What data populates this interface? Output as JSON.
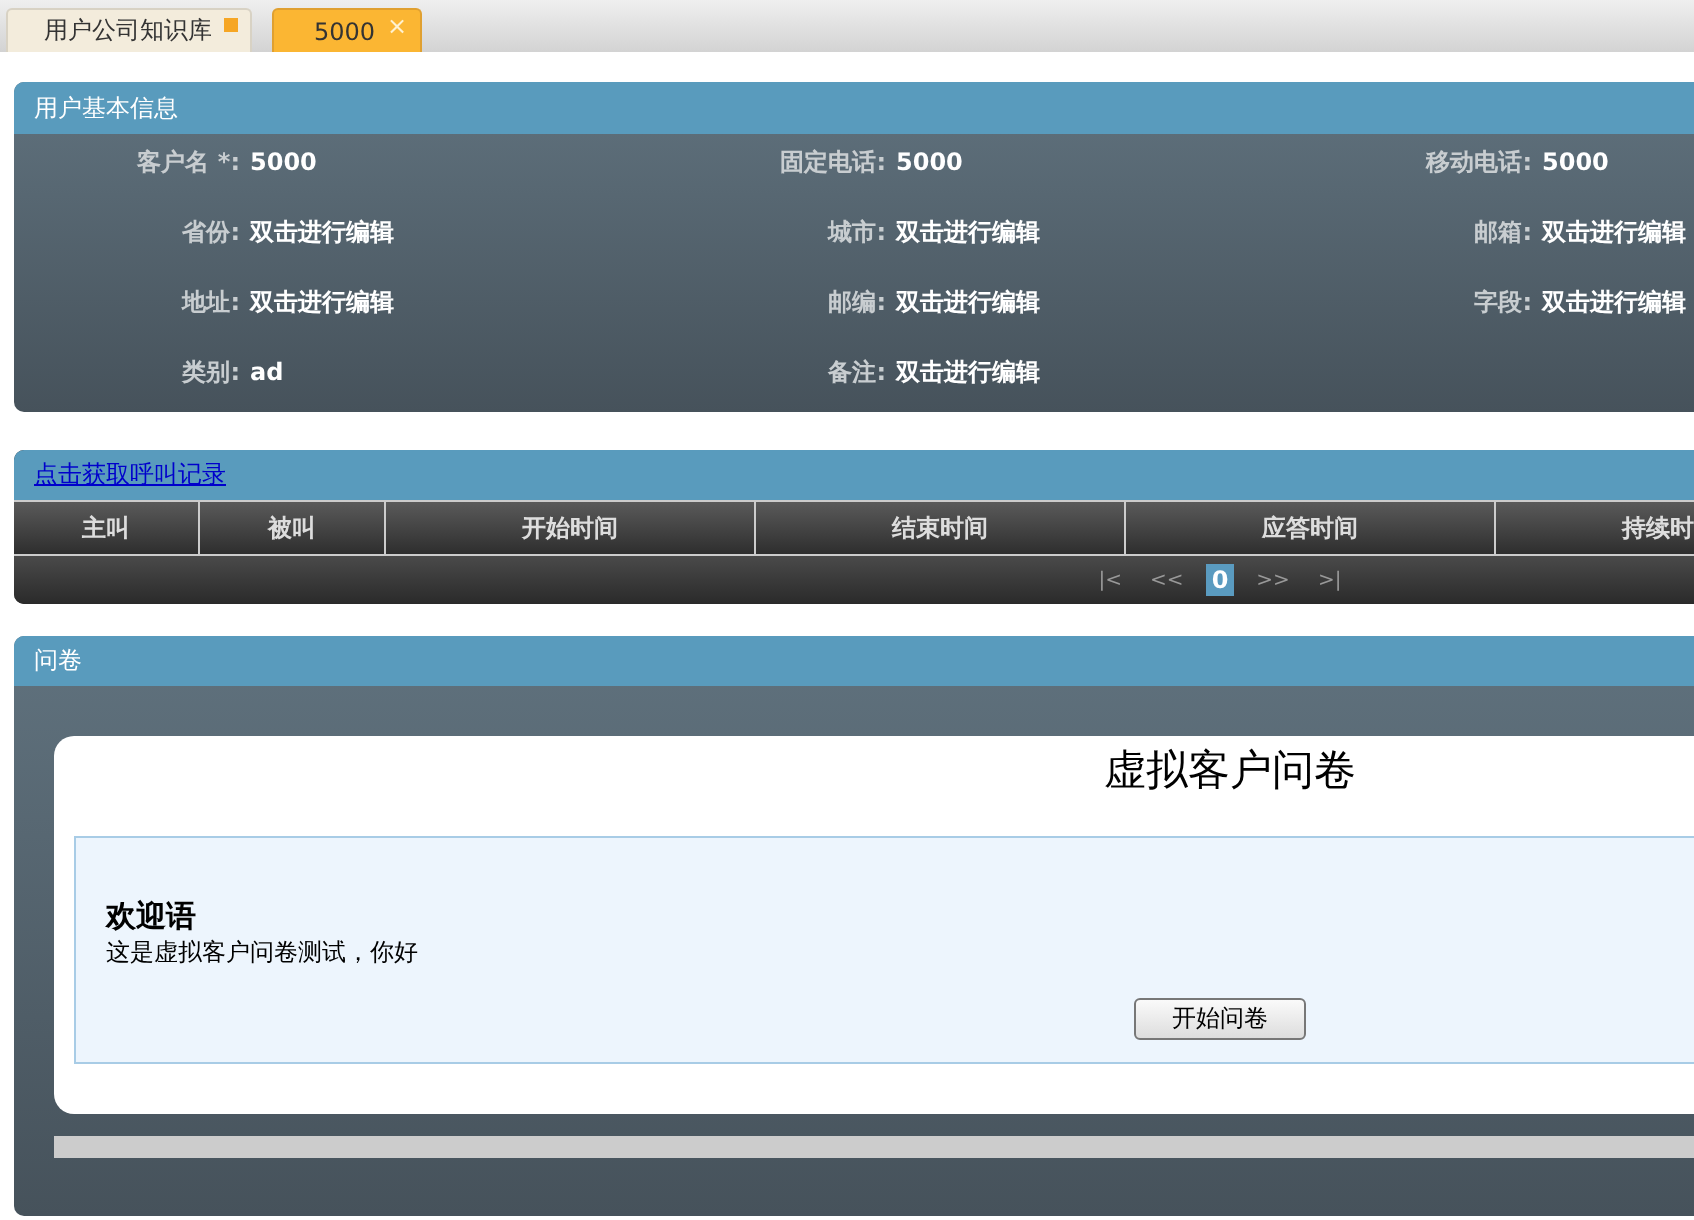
{
  "tabs": [
    {
      "label": "用户公司知识库",
      "selected": false,
      "kind": "pinned"
    },
    {
      "label": "5000",
      "selected": true,
      "kind": "closable",
      "close": "×"
    }
  ],
  "customer_info": {
    "title": "用户基本信息",
    "fields": [
      {
        "label": "客户名 *:",
        "value": "5000"
      },
      {
        "label": "固定电话:",
        "value": "5000"
      },
      {
        "label": "移动电话:",
        "value": "5000"
      },
      {
        "label": "省份:",
        "value": "双击进行编辑"
      },
      {
        "label": "城市:",
        "value": "双击进行编辑"
      },
      {
        "label": "邮箱:",
        "value": "双击进行编辑"
      },
      {
        "label": "地址:",
        "value": "双击进行编辑"
      },
      {
        "label": "邮编:",
        "value": "双击进行编辑"
      },
      {
        "label": "字段:",
        "value": "双击进行编辑"
      },
      {
        "label": "类别:",
        "value": "ad"
      },
      {
        "label": "备注:",
        "value": "双击进行编辑"
      }
    ]
  },
  "call_records": {
    "link": "点击获取呼叫记录",
    "columns": [
      "主叫",
      "被叫",
      "开始时间",
      "结束时间",
      "应答时间",
      "持续时"
    ],
    "pager": [
      {
        "label": "|<",
        "selected": false
      },
      {
        "label": "<<",
        "selected": false
      },
      {
        "label": "0",
        "selected": true
      },
      {
        "label": ">>",
        "selected": false
      },
      {
        "label": ">|",
        "selected": false
      }
    ]
  },
  "survey": {
    "title": "问卷",
    "heading": "虚拟客户问卷",
    "welcome_title": "欢迎语",
    "welcome_text": "这是虚拟客户问卷测试，你好",
    "button": "开始问卷"
  }
}
